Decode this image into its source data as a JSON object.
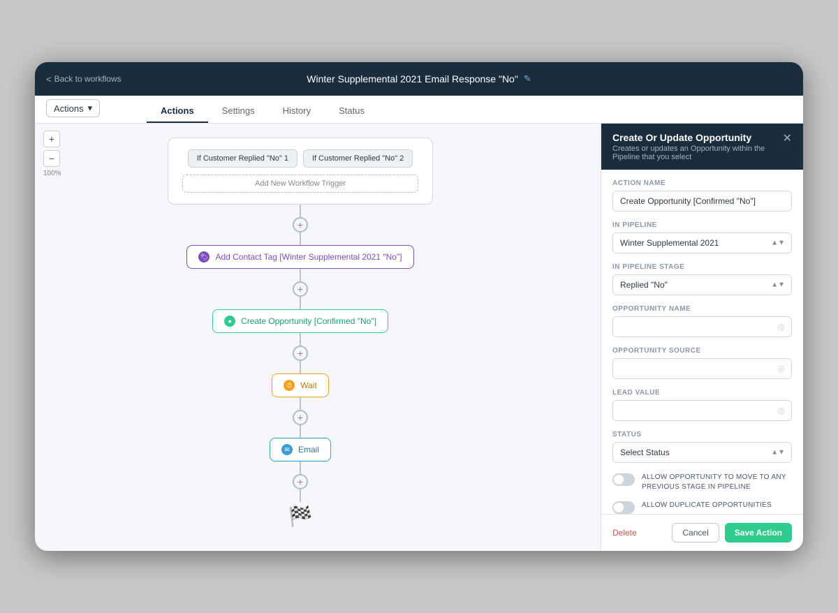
{
  "topbar": {
    "back_label": "Back to workflows",
    "title": "Winter Supplemental 2021 Email Response \"No\"",
    "edit_icon": "✎"
  },
  "tabs": [
    {
      "label": "Actions",
      "active": true
    },
    {
      "label": "Settings",
      "active": false
    },
    {
      "label": "History",
      "active": false
    },
    {
      "label": "Status",
      "active": false
    }
  ],
  "actions_dropdown": "Actions",
  "canvas": {
    "zoom_in": "+",
    "zoom_out": "−",
    "zoom_level": "100%",
    "triggers": [
      {
        "label": "If Customer Replied \"No\" 1"
      },
      {
        "label": "If Customer Replied \"No\" 2"
      }
    ],
    "add_trigger": "Add New Workflow Trigger",
    "nodes": [
      {
        "type": "tag",
        "label": "Add Contact Tag [Winter Supplemental 2021 \"No\"]",
        "icon": "🏷"
      },
      {
        "type": "opportunity",
        "label": "Create Opportunity [Confirmed \"No\"]",
        "icon": "●"
      },
      {
        "type": "wait",
        "label": "Wait",
        "icon": "⏱"
      },
      {
        "type": "email",
        "label": "Email",
        "icon": "✉"
      }
    ],
    "finish_flag": "🏁"
  },
  "panel": {
    "title": "Create Or Update Opportunity",
    "subtitle": "Creates or updates an Opportunity within the Pipeline that you select",
    "close_icon": "✕",
    "fields": {
      "action_name_label": "ACTION NAME",
      "action_name_value": "Create Opportunity [Confirmed \"No\"]",
      "in_pipeline_label": "IN PIPELINE",
      "in_pipeline_value": "Winter Supplemental 2021",
      "in_pipeline_stage_label": "IN PIPELINE STAGE",
      "in_pipeline_stage_value": "Replied \"No\"",
      "opportunity_name_label": "OPPORTUNITY NAME",
      "opportunity_name_value": "",
      "opportunity_source_label": "OPPORTUNITY SOURCE",
      "opportunity_source_value": "",
      "lead_value_label": "LEAD VALUE",
      "lead_value_value": "",
      "status_label": "STATUS",
      "status_value": "Select Status",
      "toggle1_label": "ALLOW OPPORTUNITY TO MOVE TO ANY PREVIOUS STAGE IN PIPELINE",
      "toggle2_label": "ALLOW DUPLICATE OPPORTUNITIES"
    },
    "footer": {
      "delete_label": "Delete",
      "cancel_label": "Cancel",
      "save_label": "Save Action"
    }
  }
}
